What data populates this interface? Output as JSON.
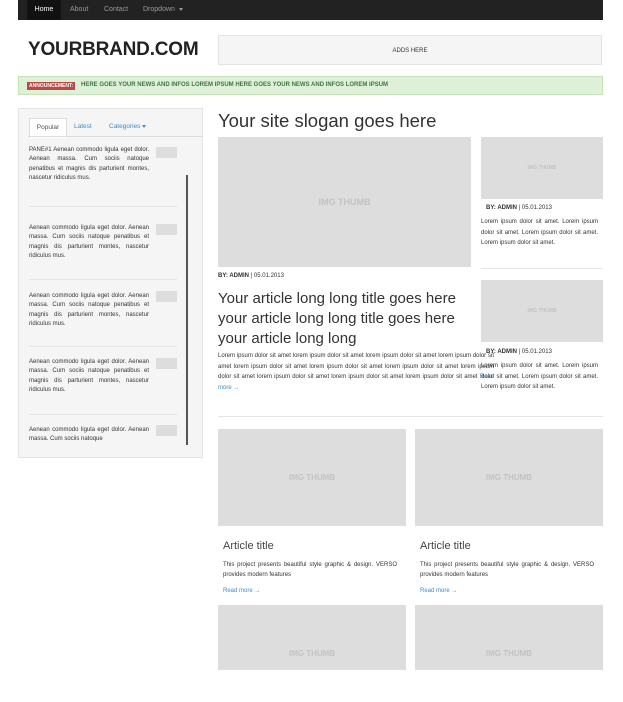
{
  "navbar": {
    "items": [
      {
        "label": "Home",
        "active": true
      },
      {
        "label": "About",
        "active": false
      },
      {
        "label": "Contact",
        "active": false
      },
      {
        "label": "Dropdown",
        "active": false,
        "dropdown": true
      }
    ]
  },
  "header": {
    "brand": "YOURBRAND.COM",
    "ads": "ADDS HERE"
  },
  "announcement": {
    "badge": "ANNOUNCEMENT:",
    "text": "HERE GOES YOUR NEWS AND INFOS LOREM IPSUM HERE GOES YOUR NEWS AND INFOS LOREM IPSUM"
  },
  "sidebar": {
    "tabs": [
      {
        "label": "Popular",
        "active": true
      },
      {
        "label": "Latest",
        "active": false
      },
      {
        "label": "Categories",
        "active": false,
        "dropdown": true
      }
    ],
    "items": [
      {
        "text": "PANE#1 Aenean commodo ligula eget dolor. Aenean massa. Cum sociis natoque penatibus et magnis dis parturient montes, nascetur ridiculus mus."
      },
      {
        "text": "Aenean commodo ligula eget dolor. Aenean massa. Cum sociis natoque penatibus et magnis dis parturient montes, nascetur ridiculus mus."
      },
      {
        "text": "Aenean commodo ligula eget dolor. Aenean massa. Cum sociis natoque penatibus et magnis dis parturient montes, nascetur ridiculus mus."
      },
      {
        "text": "Aenean commodo ligula eget dolor. Aenean massa. Cum sociis natoque penatibus et magnis dis parturient montes, nascetur ridiculus mus."
      },
      {
        "text": "Aenean commodo ligula eget dolor. Aenean massa. Cum sociis natoque"
      }
    ]
  },
  "main": {
    "slogan": "Your site slogan goes here",
    "feature": {
      "thumb": "IMG THUMB",
      "by": "BY: ADMIN",
      "date": "| 05.01.2013",
      "title": "Your article long long title goes here your article long long title goes here your article long long",
      "text": "Lorem ipsum dolor sit amet lorem ipsum dolor sit amet lorem ipsum dolor sit amet lorem ipsum dolor sit amet lorem ipsum dolor sit amet lorem ipsum dolor sit amet lorem ipsum dolor sit amet lorem ipsum dolor sit amet lorem ipsum dolor sit amet lorem ipsum dolor sit amet lorem ipsum dolor sit amet",
      "read_more": "Read more →"
    },
    "side_posts": [
      {
        "thumb": "IMG THUMB",
        "by": "BY: ADMIN",
        "date": "| 05.01.2013",
        "text": "Lorem ipsum dolor sit amet. Lorem ipsum dolor sit amet. Lorem ipsum dolor sit amet. Lorem ipsum dolor sit amet."
      },
      {
        "thumb": "IMG THUMB",
        "by": "BY: ADMIN",
        "date": "| 05.01.2013",
        "text": "Lorem ipsum dolor sit amet. Lorem ipsum dolor sit amet. Lorem ipsum dolor sit amet. Lorem ipsum dolor sit amet."
      }
    ],
    "articles": [
      {
        "thumb": "IMG THUMB",
        "title": "Article title",
        "text": "This project presents beautiful style graphic & design. VERSO provides modern features",
        "read_more": "Read more →"
      },
      {
        "thumb": "IMG THUMB",
        "title": "Article title",
        "text": "This project presents beautiful style graphic & design. VERSO provides modern features",
        "read_more": "Read more →"
      },
      {
        "thumb": "IMG THUMB"
      },
      {
        "thumb": "IMG THUMB"
      }
    ]
  },
  "colors": {
    "navbar_bg": "#222222",
    "link": "#428bca",
    "announce_bg": "#dff0d8",
    "badge": "#b94a48",
    "thumb": "#dddddd"
  }
}
